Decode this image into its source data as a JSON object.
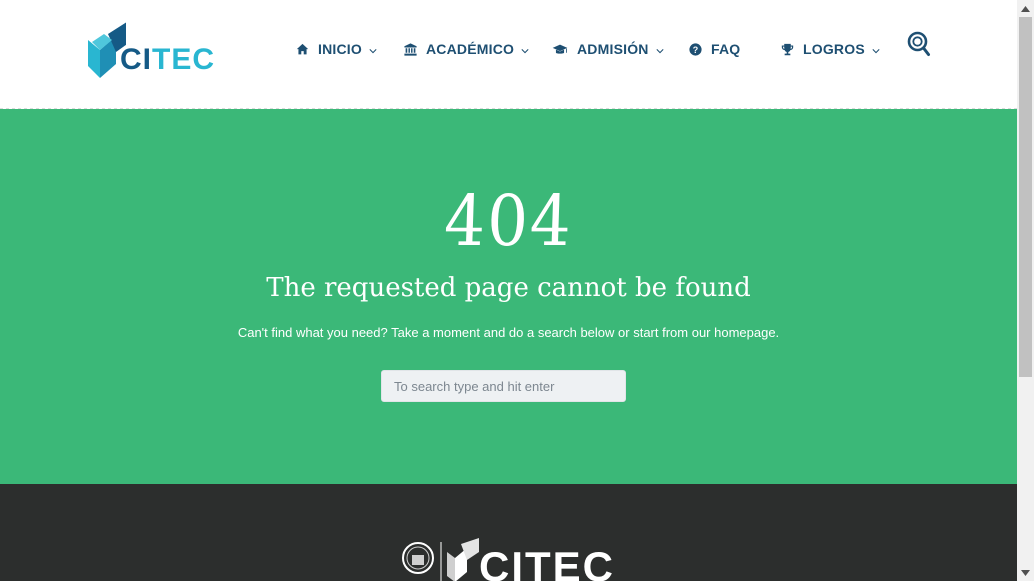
{
  "brand": {
    "logo_ci": "CI",
    "logo_tec": "TEC",
    "footer_logo_text": "CITEC"
  },
  "nav": {
    "items": [
      {
        "label": "INICIO",
        "icon": "home-icon",
        "dropdown": true
      },
      {
        "label": "ACADÉMICO",
        "icon": "institution-icon",
        "dropdown": true
      },
      {
        "label": "ADMISIÓN",
        "icon": "graduation-cap-icon",
        "dropdown": true
      },
      {
        "label": "FAQ",
        "icon": "question-circle-icon",
        "dropdown": false
      },
      {
        "label": "LOGROS",
        "icon": "trophy-icon",
        "dropdown": true
      }
    ],
    "search_icon": "search-icon"
  },
  "error": {
    "code": "404",
    "title": "The requested page cannot be found",
    "message": "Can't find what you need? Take a moment and do a search below or start from our homepage."
  },
  "search": {
    "placeholder": "To search type and hit enter",
    "value": ""
  },
  "colors": {
    "nav_text": "#1e4f72",
    "hero_bg": "#3bb878",
    "footer_bg": "#2c2e2d",
    "logo_dark": "#155a86",
    "logo_light": "#29b6d1"
  }
}
